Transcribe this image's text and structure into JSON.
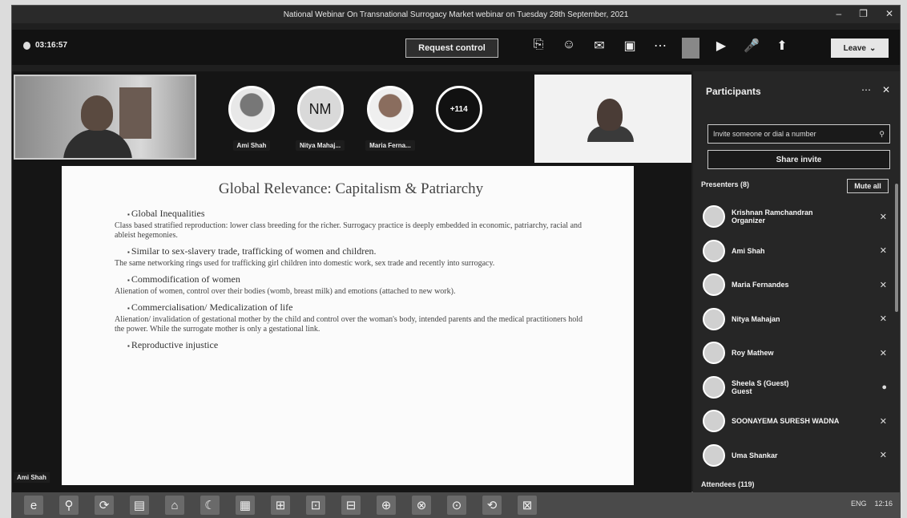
{
  "window": {
    "title": "National Webinar On Transnational Surrogacy Market webinar on Tuesday 28th September, 2021",
    "minimize": "–",
    "maximize": "❐",
    "close": "✕"
  },
  "toolbar": {
    "timer": "03:16:57",
    "request_control": "Request control",
    "icons": [
      "share-icon",
      "reactions-icon",
      "chat-icon",
      "rooms-icon",
      "more-icon",
      "camera-icon",
      "mic-icon",
      "screen-share-icon"
    ],
    "icon_glyphs": [
      "⎘",
      "☺",
      "✉",
      "▣",
      "⋯",
      "▶",
      "🎤",
      "⬆"
    ],
    "leave": "Leave",
    "leave_caret": "⌄"
  },
  "stage": {
    "avatars": [
      {
        "initials": "",
        "label": "Ami Shah"
      },
      {
        "initials": "NM",
        "label": "Nitya Mahaj..."
      },
      {
        "initials": "",
        "label": "Maria Ferna..."
      },
      {
        "initials": "+114",
        "label": ""
      }
    ],
    "presenter_tag": "Ami Shah"
  },
  "slide": {
    "title": "Global Relevance: Capitalism & Patriarchy",
    "items": [
      {
        "bullet": "Global Inequalities",
        "text": "Class based stratified reproduction: lower class breeding for the richer. Surrogacy practice is deeply embedded in economic, patriarchy, racial and ableist hegemonies."
      },
      {
        "bullet": "Similar to sex-slavery trade, trafficking of women and children.",
        "text": "The same networking rings used for trafficking girl children into domestic work, sex trade and recently into surrogacy."
      },
      {
        "bullet": "Commodification of women",
        "text": "Alienation of women, control over their bodies (womb, breast milk) and emotions (attached to new work)."
      },
      {
        "bullet": "Commercialisation/ Medicalization of life",
        "text": "Alienation/ invalidation of gestational mother by the child and control over the woman's body, intended parents and the medical practitioners hold the power. While the surrogate mother is only a gestational link."
      },
      {
        "bullet": "Reproductive injustice",
        "text": ""
      }
    ]
  },
  "panel": {
    "title": "Participants",
    "more": "⋯",
    "close": "✕",
    "search_placeholder": "Invite someone or dial a number",
    "share_invite": "Share invite",
    "presenters_label": "Presenters (8)",
    "mute_all": "Mute all",
    "participants": [
      {
        "name": "Krishnan Ramchandran",
        "role": "Organizer"
      },
      {
        "name": "Ami Shah",
        "role": ""
      },
      {
        "name": "Maria Fernandes",
        "role": ""
      },
      {
        "name": "Nitya Mahajan",
        "role": ""
      },
      {
        "name": "Roy Mathew",
        "role": ""
      },
      {
        "name": "Sheela S (Guest)",
        "role": "Guest"
      },
      {
        "name": "SOONAYEMA SURESH WADNA",
        "role": ""
      },
      {
        "name": "Uma Shankar",
        "role": ""
      }
    ],
    "attendees_label": "Attendees (119)"
  },
  "taskbar": {
    "icons": [
      "e",
      "⚲",
      "⟳",
      "▤",
      "⌂",
      "☾",
      "▦",
      "⊞",
      "⊡",
      "⊟",
      "⊕",
      "⊗",
      "⊙",
      "⟲",
      "⊠"
    ],
    "tray_text": "ENG",
    "clock": "12:16"
  }
}
